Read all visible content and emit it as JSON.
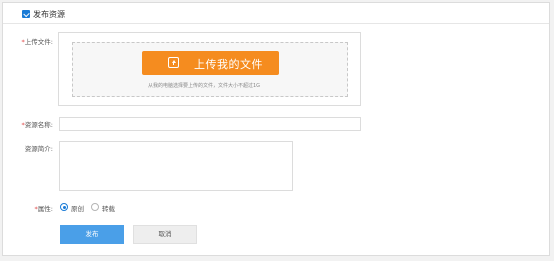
{
  "header": {
    "title": "发布资源"
  },
  "required_mark": "*",
  "upload": {
    "label": "上传文件:",
    "button_label": "上传我的文件",
    "hint": "从我的电脑选择要上传的文件，文件大小不超过1G"
  },
  "name_field": {
    "label": "资源名称:",
    "value": ""
  },
  "intro_field": {
    "label": "资源简介:",
    "value": ""
  },
  "attribute": {
    "label": "属性:",
    "options": [
      {
        "label": "原创",
        "checked": true
      },
      {
        "label": "转载",
        "checked": false
      }
    ]
  },
  "actions": {
    "submit_label": "发布",
    "cancel_label": "取消"
  },
  "colors": {
    "accent": "#1a7bd6",
    "upload_button": "#f58c1f",
    "submit_button": "#4a9fe8",
    "required": "#e04848"
  }
}
